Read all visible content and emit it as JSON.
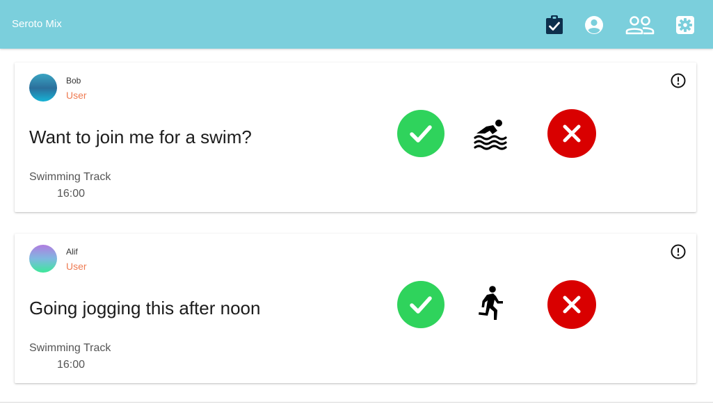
{
  "app": {
    "title": "Seroto Mix"
  },
  "nav": {
    "icons": [
      "clipboard-check-icon",
      "account-circle-icon",
      "people-outline-icon",
      "settings-icon"
    ]
  },
  "colors": {
    "header": "#7bcfdc",
    "accept": "#2fd35c",
    "reject": "#d90000",
    "role": "#ef7b52"
  },
  "invitations": [
    {
      "user": {
        "name": "Bob",
        "role": "User"
      },
      "message": "Want to join me for a swim?",
      "activity_icon": "swimming-icon",
      "location": "Swimming Track",
      "time": "16:00"
    },
    {
      "user": {
        "name": "Alif",
        "role": "User"
      },
      "message": "Going jogging this after noon",
      "activity_icon": "running-icon",
      "location": "Swimming Track",
      "time": "16:00"
    }
  ]
}
